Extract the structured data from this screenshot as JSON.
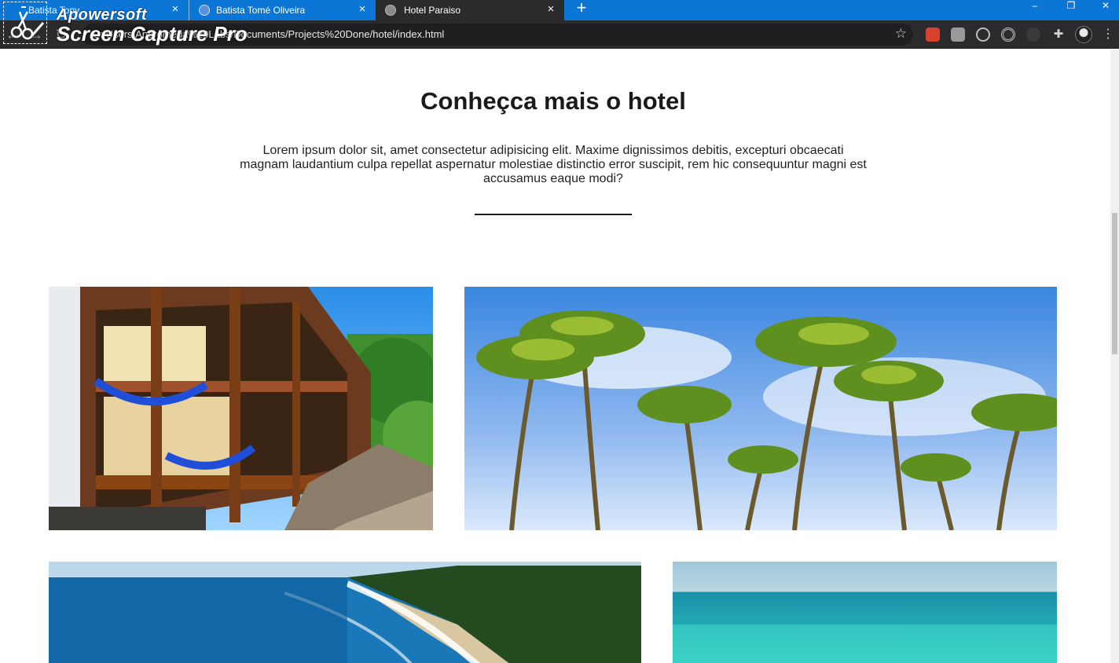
{
  "browser": {
    "tabs": [
      {
        "title": "Batista Tony",
        "close_icon": "×"
      },
      {
        "title": "Batista Tomé Oliveira",
        "close_icon": "×"
      },
      {
        "title": "Hotel Paraiso",
        "close_icon": "×"
      }
    ],
    "new_tab_icon": "+",
    "url": "C:/Users/Andromeda%20Labs/Documents/Projects%20Done/hotel/index.html",
    "window_controls": {
      "minimize": "–",
      "restore": "❐",
      "close": "✕"
    }
  },
  "watermark": {
    "brand": "Apowersoft",
    "product": "Screen Capture Pro"
  },
  "section": {
    "title": "Conheçca mais o hotel",
    "description": "Lorem ipsum dolor sit, amet consectetur adipisicing elit. Maxime dignissimos debitis, excepturi obcaecati magnam laudantium culpa repellat aspernatur molestiae distinctio error suscipit, rem hic consequuntur magni est accusamus eaque modi?"
  },
  "gallery": [
    {
      "subject": "hotel-wooden-balconies-with-hammocks"
    },
    {
      "subject": "palm-trees-blue-sky"
    },
    {
      "subject": "aerial-beach-coastline"
    },
    {
      "subject": "turquoise-sea-horizon"
    }
  ],
  "colors": {
    "tabbar": "#0b76d6",
    "toolbar": "#2b2b2e",
    "heading": "#1a1a1a"
  }
}
